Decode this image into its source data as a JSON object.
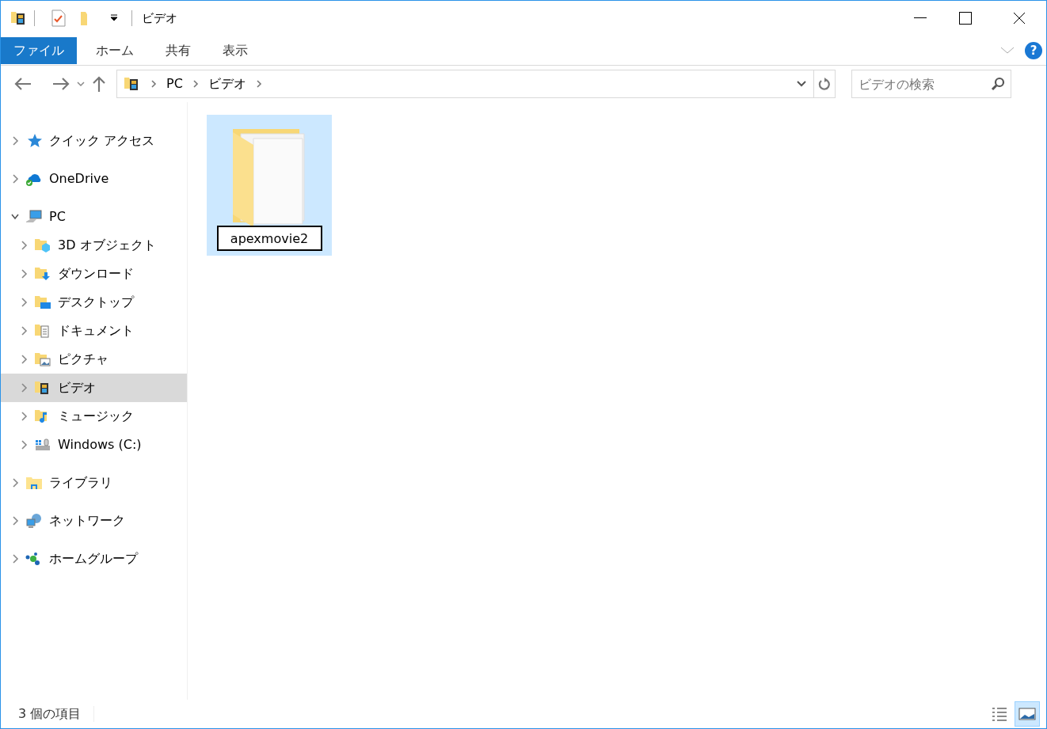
{
  "window": {
    "title": "ビデオ"
  },
  "ribbon_tabs": [
    {
      "label": "ファイル",
      "selected": true
    },
    {
      "label": "ホーム",
      "selected": false
    },
    {
      "label": "共有",
      "selected": false
    },
    {
      "label": "表示",
      "selected": false
    }
  ],
  "help": {
    "glyph": "?"
  },
  "address": {
    "crumbs": [
      "PC",
      "ビデオ"
    ]
  },
  "search": {
    "placeholder": "ビデオの検索"
  },
  "sidebar": {
    "items": [
      {
        "label": "クイック アクセス",
        "kind": "star",
        "expanded": false,
        "selected": false
      },
      {
        "label": "OneDrive",
        "kind": "cloud",
        "expanded": false,
        "selected": false
      },
      {
        "label": "PC",
        "kind": "computer",
        "expanded": true,
        "selected": false,
        "children": [
          {
            "label": "3D オブジェクト",
            "kind": "cube",
            "expanded": false,
            "selected": false
          },
          {
            "label": "ダウンロード",
            "kind": "download",
            "expanded": false,
            "selected": false
          },
          {
            "label": "デスクトップ",
            "kind": "desktop",
            "expanded": false,
            "selected": false
          },
          {
            "label": "ドキュメント",
            "kind": "document",
            "expanded": false,
            "selected": false
          },
          {
            "label": "ピクチャ",
            "kind": "picture",
            "expanded": false,
            "selected": false
          },
          {
            "label": "ビデオ",
            "kind": "video",
            "expanded": false,
            "selected": true
          },
          {
            "label": "ミュージック",
            "kind": "music",
            "expanded": false,
            "selected": false
          },
          {
            "label": "Windows (C:)",
            "kind": "drive",
            "expanded": false,
            "selected": false
          }
        ]
      },
      {
        "label": "ライブラリ",
        "kind": "library",
        "expanded": false,
        "selected": false
      },
      {
        "label": "ネットワーク",
        "kind": "network",
        "expanded": false,
        "selected": false
      },
      {
        "label": "ホームグループ",
        "kind": "homegroup",
        "expanded": false,
        "selected": false
      }
    ]
  },
  "files": [
    {
      "name": "apexmovie2",
      "selected": true,
      "renaming": true
    }
  ],
  "status_bar": {
    "count": "3 個の項目"
  }
}
